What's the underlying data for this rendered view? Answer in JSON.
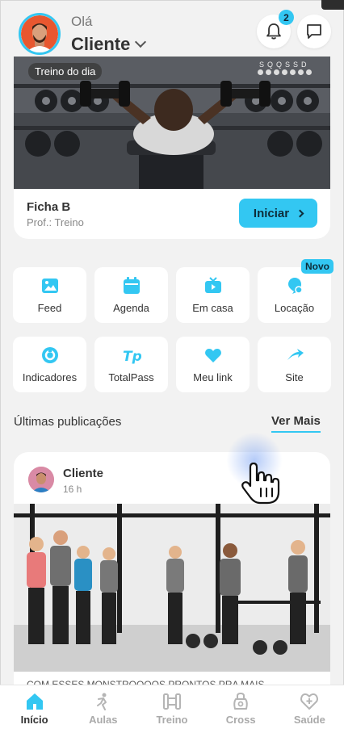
{
  "header": {
    "greeting": "Olá",
    "user_name": "Cliente",
    "notification_count": "2",
    "icons": {
      "avatar": "user-avatar",
      "bell": "bell-icon",
      "chat": "chat-icon",
      "dropdown": "chevron-down-icon"
    }
  },
  "workout_card": {
    "tag": "Treino do dia",
    "week_days": "SQQSSD",
    "title": "Ficha B",
    "subtitle": "Prof.: Treino",
    "start_label": "Iniciar"
  },
  "shortcuts": [
    {
      "label": "Feed",
      "icon": "image-icon"
    },
    {
      "label": "Agenda",
      "icon": "calendar-icon"
    },
    {
      "label": "Em casa",
      "icon": "tv-icon"
    },
    {
      "label": "Locação",
      "icon": "location-icon",
      "badge": "Novo"
    },
    {
      "label": "Indicadores",
      "icon": "indicator-icon"
    },
    {
      "label": "TotalPass",
      "icon": "totalpass-icon"
    },
    {
      "label": "Meu link",
      "icon": "heart-icon"
    },
    {
      "label": "Site",
      "icon": "arrow-icon"
    }
  ],
  "publications": {
    "title": "Últimas publicações",
    "see_more": "Ver Mais",
    "post": {
      "author": "Cliente",
      "time": "16 h",
      "caption": "COM ESSES MONSTROOOOS PRONTOS PRA MAIS"
    }
  },
  "bottom_nav": [
    {
      "label": "Início",
      "icon": "home-icon",
      "active": true
    },
    {
      "label": "Aulas",
      "icon": "classes-icon",
      "active": false
    },
    {
      "label": "Treino",
      "icon": "dumbbell-icon",
      "active": false
    },
    {
      "label": "Cross",
      "icon": "kettlebell-icon",
      "active": false
    },
    {
      "label": "Saúde",
      "icon": "health-heart-icon",
      "active": false
    }
  ],
  "colors": {
    "accent": "#33c7f2",
    "background": "#f2f2f2",
    "text": "#333333",
    "muted": "#888888"
  }
}
